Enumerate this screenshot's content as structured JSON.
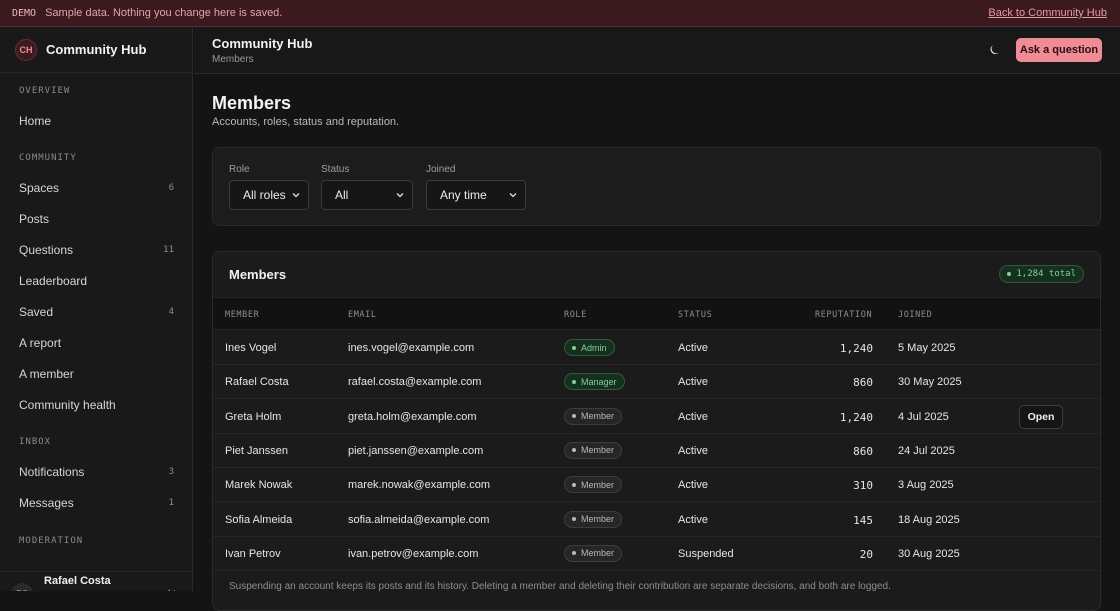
{
  "banner": {
    "tag": "DEMO",
    "message": "Sample data. Nothing you change here is saved.",
    "back_link": "Back to Community Hub"
  },
  "sidebar": {
    "brand_initials": "CH",
    "brand_name": "Community Hub",
    "sections": [
      {
        "label": "OVERVIEW",
        "items": [
          {
            "label": "Home",
            "count": ""
          }
        ]
      },
      {
        "label": "COMMUNITY",
        "items": [
          {
            "label": "Spaces",
            "count": "6"
          },
          {
            "label": "Posts",
            "count": ""
          },
          {
            "label": "Questions",
            "count": "11"
          },
          {
            "label": "Leaderboard",
            "count": ""
          },
          {
            "label": "Saved",
            "count": "4"
          },
          {
            "label": "A report",
            "count": ""
          },
          {
            "label": "A member",
            "count": ""
          },
          {
            "label": "Community health",
            "count": ""
          }
        ]
      },
      {
        "label": "INBOX",
        "items": [
          {
            "label": "Notifications",
            "count": "3"
          },
          {
            "label": "Messages",
            "count": "1"
          }
        ]
      },
      {
        "label": "MODERATION",
        "items": []
      }
    ],
    "user": {
      "initials": "RC",
      "name": "Rafael Costa"
    }
  },
  "topbar": {
    "title": "Community Hub",
    "breadcrumb": "Members",
    "ask_button": "Ask a question",
    "theme_icon": "moon-icon"
  },
  "page": {
    "title": "Members",
    "subtitle": "Accounts, roles, status and reputation."
  },
  "filters": {
    "role": {
      "label": "Role",
      "value": "All roles"
    },
    "status": {
      "label": "Status",
      "value": "All"
    },
    "joined": {
      "label": "Joined",
      "value": "Any time"
    }
  },
  "table": {
    "title": "Members",
    "total_badge": "1,284 total",
    "columns": [
      "MEMBER",
      "EMAIL",
      "ROLE",
      "STATUS",
      "REPUTATION",
      "JOINED"
    ],
    "rows": [
      {
        "member": "Ines Vogel",
        "email": "ines.vogel@example.com",
        "role": "Admin",
        "status": "Active",
        "reputation": "1,240",
        "joined": "5 May 2025",
        "action": ""
      },
      {
        "member": "Rafael Costa",
        "email": "rafael.costa@example.com",
        "role": "Manager",
        "status": "Active",
        "reputation": "860",
        "joined": "30 May 2025",
        "action": ""
      },
      {
        "member": "Greta Holm",
        "email": "greta.holm@example.com",
        "role": "Member",
        "status": "Active",
        "reputation": "1,240",
        "joined": "4 Jul 2025",
        "action": "Open"
      },
      {
        "member": "Piet Janssen",
        "email": "piet.janssen@example.com",
        "role": "Member",
        "status": "Active",
        "reputation": "860",
        "joined": "24 Jul 2025",
        "action": ""
      },
      {
        "member": "Marek Nowak",
        "email": "marek.nowak@example.com",
        "role": "Member",
        "status": "Active",
        "reputation": "310",
        "joined": "3 Aug 2025",
        "action": ""
      },
      {
        "member": "Sofia Almeida",
        "email": "sofia.almeida@example.com",
        "role": "Member",
        "status": "Active",
        "reputation": "145",
        "joined": "18 Aug 2025",
        "action": ""
      },
      {
        "member": "Ivan Petrov",
        "email": "ivan.petrov@example.com",
        "role": "Member",
        "status": "Suspended",
        "reputation": "20",
        "joined": "30 Aug 2025",
        "action": ""
      }
    ],
    "footnote": "Suspending an account keeps its posts and its history. Deleting a member and deleting their contribution are separate decisions, and both are logged."
  },
  "colors": {
    "accent": "#f08c95",
    "positive": "#7fd39a",
    "background": "#141414"
  }
}
